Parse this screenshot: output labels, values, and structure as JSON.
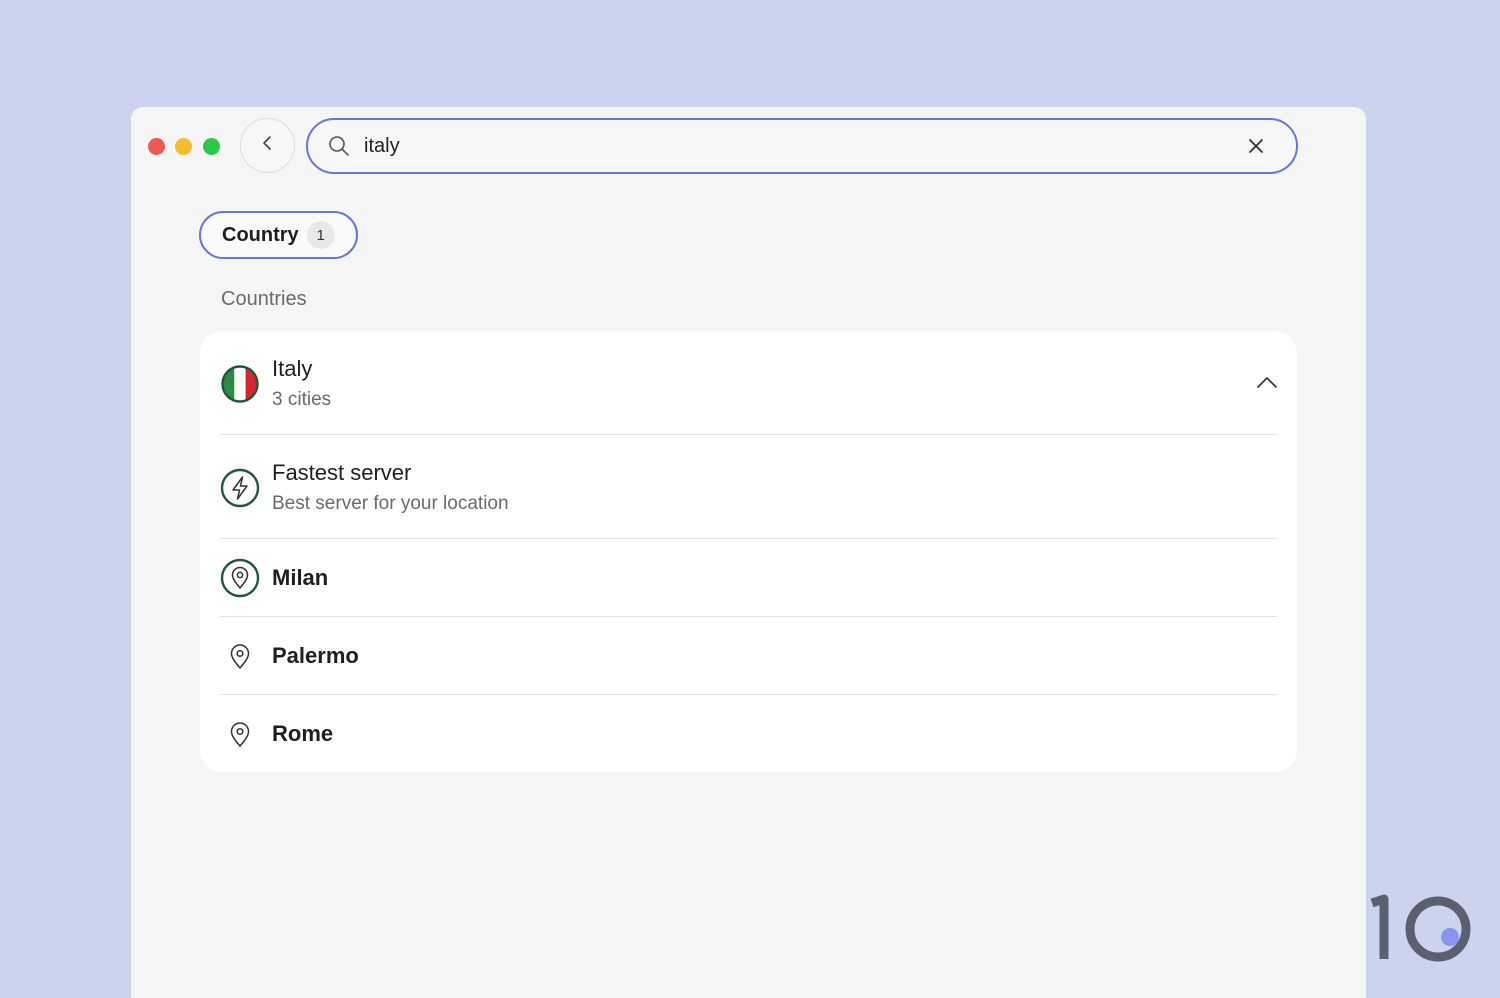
{
  "window": {
    "traffic_lights": [
      "close",
      "minimize",
      "maximize"
    ]
  },
  "toolbar": {
    "back_icon": "chevron-left-icon",
    "search": {
      "value": "italy",
      "placeholder": "",
      "search_icon": "search-icon",
      "clear_icon": "close-icon"
    }
  },
  "filters": {
    "chip_label": "Country",
    "chip_count": "1"
  },
  "results": {
    "section_title": "Countries",
    "country": {
      "name": "Italy",
      "subtitle": "3 cities",
      "flag_colors": [
        "#2e8b43",
        "#ffffff",
        "#d7262f"
      ],
      "expanded_icon": "chevron-up-icon"
    },
    "items": [
      {
        "title": "Fastest server",
        "subtitle": "Best server for your location",
        "icon": "lightning-bolt-icon"
      },
      {
        "title": "Milan",
        "icon": "map-pin-icon"
      },
      {
        "title": "Palermo",
        "icon": "map-pin-icon"
      },
      {
        "title": "Rome",
        "icon": "map-pin-icon"
      }
    ]
  },
  "branding": {
    "logo_text": "10"
  },
  "colors": {
    "accent": "#6874e0",
    "icon_green": "#1e5a3a",
    "background": "#cbd3ee"
  }
}
